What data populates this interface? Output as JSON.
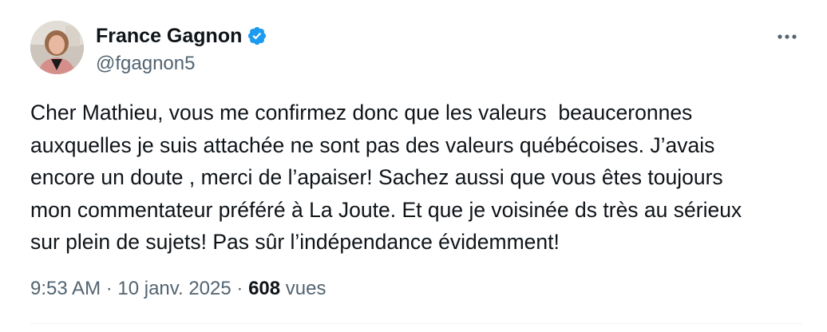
{
  "author": {
    "display_name": "France Gagnon",
    "handle": "@fgagnon5",
    "verified": true,
    "verified_color": "#1d9bf0"
  },
  "icons": {
    "avatar": "avatar-photo",
    "verified": "verified-badge-icon",
    "more": "more-options-icon"
  },
  "tweet": {
    "lines": [
      "Cher Mathieu, vous me confirmez donc que les valeurs  beauceronnes",
      "auxquelles je suis attachée ne sont pas des valeurs québécoises. J’avais",
      "encore un doute , merci de l’apaiser! Sachez aussi que vous êtes toujours",
      "mon commentateur préféré à La Joute. Et que je voisinée ds très au sérieux",
      "sur plein de sujets! Pas sûr l’indépendance évidemment!"
    ]
  },
  "meta": {
    "time": "9:53 AM",
    "separator": " · ",
    "date": "10 janv. 2025",
    "views_count": "608",
    "views_label": "vues"
  },
  "colors": {
    "text_primary": "#0f1419",
    "text_secondary": "#536471",
    "divider": "#eff3f4"
  }
}
